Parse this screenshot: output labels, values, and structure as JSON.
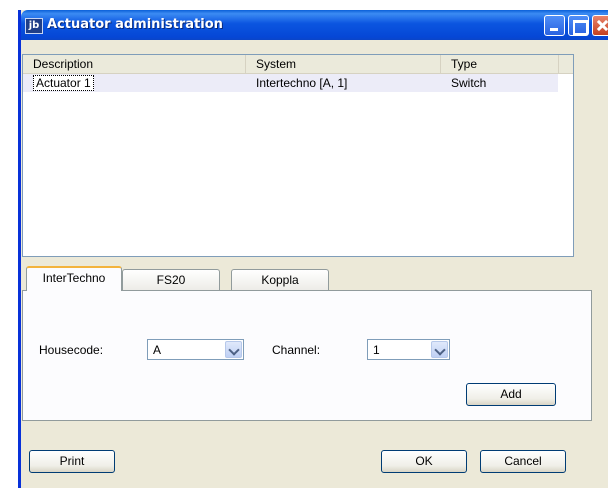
{
  "window": {
    "title": "Actuator administration",
    "app_icon": "jb"
  },
  "list": {
    "columns": [
      "Description",
      "System",
      "Type"
    ],
    "rows": [
      [
        "Actuator 1",
        "Intertechno [A, 1]",
        "Switch"
      ]
    ]
  },
  "tabs": {
    "items": [
      "InterTechno",
      "FS20",
      "Koppla"
    ],
    "active": "InterTechno"
  },
  "form": {
    "housecode_label": "Housecode:",
    "housecode_value": "A",
    "channel_label": "Channel:",
    "channel_value": "1",
    "add_label": "Add"
  },
  "footer": {
    "print_label": "Print",
    "ok_label": "OK",
    "cancel_label": "Cancel"
  }
}
